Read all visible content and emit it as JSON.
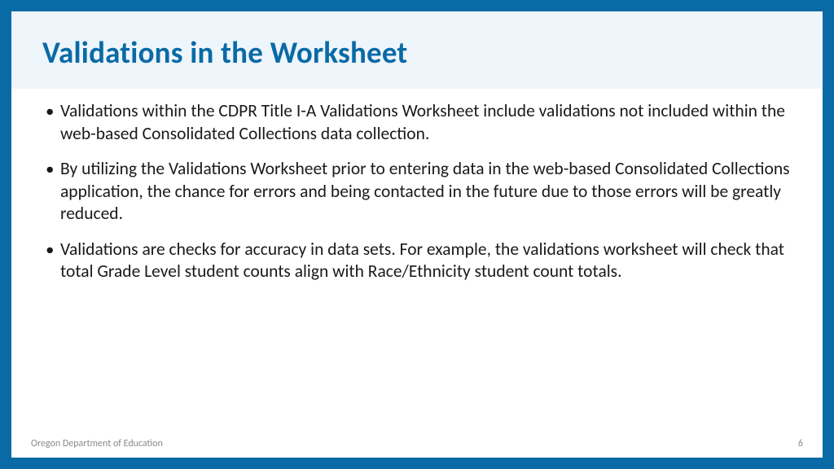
{
  "title": "Validations in the Worksheet",
  "bullets": [
    "Validations within the CDPR Title I-A Validations Worksheet include validations not included within the web-based Consolidated Collections data collection.",
    "By utilizing the Validations Worksheet prior to entering data in the web-based Consolidated Collections application, the chance for errors and being contacted in the future due to those errors will be greatly reduced.",
    "Validations are checks for accuracy in data sets. For example, the validations worksheet will check that total Grade Level student counts align with Race/Ethnicity student count totals."
  ],
  "footer": {
    "org": "Oregon Department of Education",
    "page": "6"
  }
}
